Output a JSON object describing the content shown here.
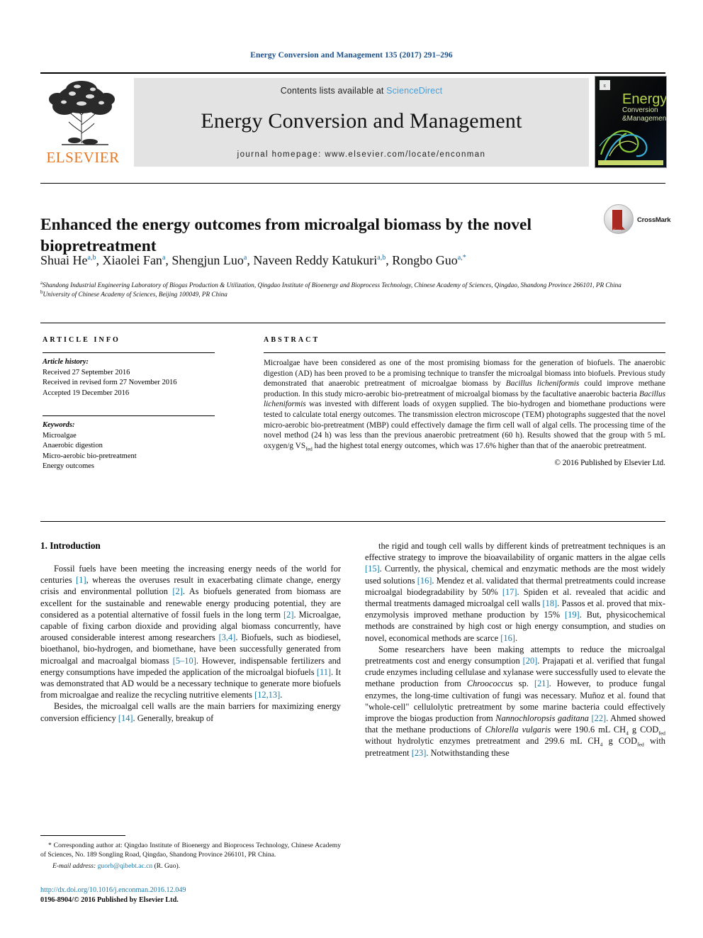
{
  "running_head": "Energy Conversion and Management 135 (2017) 291–296",
  "masthead": {
    "publisher": "ELSEVIER",
    "contents_prefix": "Contents lists available at ",
    "contents_link": "ScienceDirect",
    "journal_title": "Energy Conversion and Management",
    "homepage_prefix": "journal homepage: ",
    "homepage_url": "www.elsevier.com/locate/enconman",
    "cover_title_line1": "Energy",
    "cover_title_line2": "Conversion",
    "cover_title_line3": "Management",
    "cover_amp": "&"
  },
  "article": {
    "title": "Enhanced the energy outcomes from microalgal biomass by the novel biopretreatment",
    "crossmark_label": "CrossMark",
    "authors": [
      {
        "name": "Shuai He",
        "sup": "a,b",
        "sep": ", "
      },
      {
        "name": "Xiaolei Fan",
        "sup": "a",
        "sep": ", "
      },
      {
        "name": "Shengjun Luo",
        "sup": "a",
        "sep": ", "
      },
      {
        "name": "Naveen Reddy Katukuri",
        "sup": "a,b",
        "sep": ", "
      },
      {
        "name": "Rongbo Guo",
        "sup": "a,*",
        "sep": ""
      }
    ],
    "affiliations": [
      {
        "marker": "a",
        "text": "Shandong Industrial Engineering Laboratory of Biogas Production & Utilization, Qingdao Institute of Bioenergy and Bioprocess Technology, Chinese Academy of Sciences, Qingdao, Shandong Province 266101, PR China"
      },
      {
        "marker": "b",
        "text": "University of Chinese Academy of Sciences, Beijing 100049, PR China"
      }
    ]
  },
  "article_info": {
    "header": "ARTICLE INFO",
    "history_heading": "Article history:",
    "history": [
      "Received 27 September 2016",
      "Received in revised form 27 November 2016",
      "Accepted 19 December 2016"
    ],
    "keywords_heading": "Keywords:",
    "keywords": [
      "Microalgae",
      "Anaerobic digestion",
      "Micro-aerobic bio-pretreatment",
      "Energy outcomes"
    ]
  },
  "abstract": {
    "header": "ABSTRACT",
    "text_parts": [
      {
        "t": "Microalgae have been considered as one of the most promising biomass for the generation of biofuels. The anaerobic digestion (AD) has been proved to be a promising technique to transfer the microalgal biomass into biofuels. Previous study demonstrated that anaerobic pretreatment of microalgae biomass by "
      },
      {
        "i": "Bacillus licheniformis"
      },
      {
        "t": " could improve methane production. In this study micro-aerobic bio-pretreatment of microalgal biomass by the facultative anaerobic bacteria "
      },
      {
        "i": "Bacillus licheniformis"
      },
      {
        "t": " was invested with different loads of oxygen supplied. The bio-hydrogen and biomethane productions were tested to calculate total energy outcomes. The transmission electron microscope (TEM) photographs suggested that the novel micro-aerobic bio-pretreatment (MBP) could effectively damage the firm cell wall of algal cells. The processing time of the novel method (24 h) was less than the previous anaerobic pretreatment (60 h). Results showed that the group with 5 mL oxygen/g VS"
      },
      {
        "sub": "fed"
      },
      {
        "t": " had the highest total energy outcomes, which was 17.6% higher than that of the anaerobic pretreatment."
      }
    ],
    "copyright": "© 2016 Published by Elsevier Ltd."
  },
  "body": {
    "section_heading": "1. Introduction",
    "left_paragraphs": [
      [
        {
          "t": "Fossil fuels have been meeting the increasing energy needs of the world for centuries "
        },
        {
          "r": "[1]"
        },
        {
          "t": ", whereas the overuses result in exacerbating climate change, energy crisis and environmental pollution "
        },
        {
          "r": "[2]"
        },
        {
          "t": ". As biofuels generated from biomass are excellent for the sustainable and renewable energy producing potential, they are considered as a potential alternative of fossil fuels in the long term "
        },
        {
          "r": "[2]"
        },
        {
          "t": ". Microalgae, capable of fixing carbon dioxide and providing algal biomass concurrently, have aroused considerable interest among researchers "
        },
        {
          "r": "[3,4]"
        },
        {
          "t": ". Biofuels, such as biodiesel, bioethanol, bio-hydrogen, and biomethane, have been successfully generated from microalgal and macroalgal biomass "
        },
        {
          "r": "[5–10]"
        },
        {
          "t": ". However, indispensable fertilizers and energy consumptions have impeded the application of the microalgal biofuels "
        },
        {
          "r": "[11]"
        },
        {
          "t": ". It was demonstrated that AD would be a necessary technique to generate more biofuels from microalgae and realize the recycling nutritive elements "
        },
        {
          "r": "[12,13]"
        },
        {
          "t": "."
        }
      ],
      [
        {
          "t": "Besides, the microalgal cell walls are the main barriers for maximizing energy conversion efficiency "
        },
        {
          "r": "[14]"
        },
        {
          "t": ". Generally, breakup of"
        }
      ]
    ],
    "right_paragraphs": [
      [
        {
          "t": "the rigid and tough cell walls by different kinds of pretreatment techniques is an effective strategy to improve the bioavailability of organic matters in the algae cells "
        },
        {
          "r": "[15]"
        },
        {
          "t": ". Currently, the physical, chemical and enzymatic methods are the most widely used solutions "
        },
        {
          "r": "[16]"
        },
        {
          "t": ". Mendez et al. validated that thermal pretreatments could increase microalgal biodegradability by 50% "
        },
        {
          "r": "[17]"
        },
        {
          "t": ". Spiden et al. revealed that acidic and thermal treatments damaged microalgal cell walls "
        },
        {
          "r": "[18]"
        },
        {
          "t": ". Passos et al. proved that mix-enzymolysis improved methane production by 15% "
        },
        {
          "r": "[19]"
        },
        {
          "t": ". But, physicochemical methods are constrained by high cost or high energy consumption, and studies on novel, economical methods are scarce "
        },
        {
          "r": "[16]"
        },
        {
          "t": "."
        }
      ],
      [
        {
          "t": "Some researchers have been making attempts to reduce the microalgal pretreatments cost and energy consumption "
        },
        {
          "r": "[20]"
        },
        {
          "t": ". Prajapati et al. verified that fungal crude enzymes including cellulase and xylanase were successfully used to elevate the methane production from "
        },
        {
          "i": "Chroococcus"
        },
        {
          "t": " sp. "
        },
        {
          "r": "[21]"
        },
        {
          "t": ". However, to produce fungal enzymes, the long-time cultivation of fungi was necessary. Muñoz et al. found that \"whole-cell\" cellulolytic pretreatment by some marine bacteria could effectively improve the biogas production from "
        },
        {
          "i": "Nannochloropsis gaditana"
        },
        {
          "t": " "
        },
        {
          "r": "[22]"
        },
        {
          "t": ". Ahmed showed that the methane productions of "
        },
        {
          "i": "Chlorella vulgaris"
        },
        {
          "t": " were 190.6 mL CH"
        },
        {
          "sub": "4"
        },
        {
          "t": " g COD"
        },
        {
          "sub": "fed"
        },
        {
          "t": " without hydrolytic enzymes pretreatment and 299.6 mL CH"
        },
        {
          "sub": "4"
        },
        {
          "t": " g COD"
        },
        {
          "sub": "fed"
        },
        {
          "t": " with pretreatment "
        },
        {
          "r": "[23]"
        },
        {
          "t": ". Notwithstanding these"
        }
      ]
    ]
  },
  "footnote": {
    "corresponding": "* Corresponding author at: Qingdao Institute of Bioenergy and Bioprocess Technology, Chinese Academy of Sciences, No. 189 Songling Road, Qingdao, Shandong Province 266101, PR China.",
    "email_label": "E-mail address:",
    "email": "guorb@qibebt.ac.cn",
    "email_suffix": "(R. Guo)."
  },
  "doi": {
    "url": "http://dx.doi.org/10.1016/j.enconman.2016.12.049",
    "issn_line": "0196-8904/© 2016 Published by Elsevier Ltd."
  },
  "colors": {
    "link": "#1a7aa8",
    "runhead": "#1a4f8a",
    "sciencedirect": "#4a9fd8",
    "elsevier_orange": "#e87722",
    "crossmark_red": "#a82a20"
  }
}
